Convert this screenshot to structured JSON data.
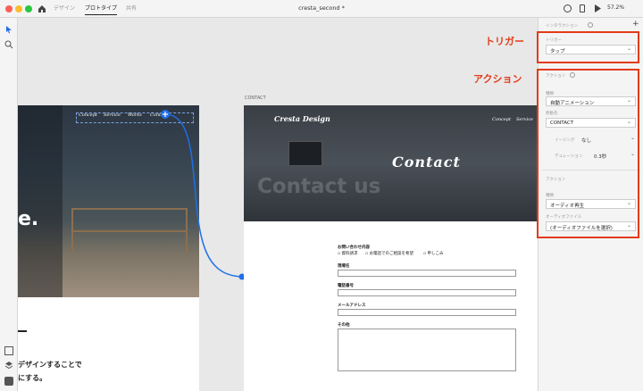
{
  "titlebar": {
    "tab_design": "デザイン",
    "tab_prototype": "プロトタイプ",
    "tab_share": "共有",
    "doc_title": "cresta_second *",
    "zoom": "57.2%"
  },
  "artboard_left": {
    "nav": [
      "Concept",
      "Service",
      "Works",
      "Conta"
    ],
    "hero_char": "e.",
    "text_line1": "デザインすることで",
    "text_line2": "にする。"
  },
  "artboard_right": {
    "label": "CONTACT",
    "brand": "Cresta Design",
    "nav": [
      "Concept",
      "Service"
    ],
    "title": "Contact",
    "watermark": "Contact us",
    "form": {
      "heading": "お問い合わせ内容",
      "options": [
        "資料請求",
        "お電話でのご相談を希望",
        "申しこみ"
      ],
      "company": "現場名",
      "phone": "電話番号",
      "email": "メールアドレス",
      "other": "その他"
    }
  },
  "panel": {
    "section_title": "インタラクション",
    "trigger_label": "トリガー",
    "trigger_value": "タップ",
    "action_label": "アクション",
    "type_label": "種類",
    "type_value": "自動アニメーション",
    "dest_label": "移動先",
    "dest_value": "CONTACT",
    "easing_label": "イージング",
    "easing_value": "なし",
    "duration_label": "デュレーション",
    "duration_value": "0.3秒",
    "action2_label": "アクション",
    "type2_label": "種類",
    "type2_value": "オーディオ再生",
    "audio_label": "オーディオファイル",
    "audio_value": "(オーディオファイルを選択)"
  },
  "annotations": {
    "trigger": "トリガー",
    "action": "アクション"
  },
  "colors": {
    "accent": "#e23b18",
    "link": "#1f6fe8"
  }
}
